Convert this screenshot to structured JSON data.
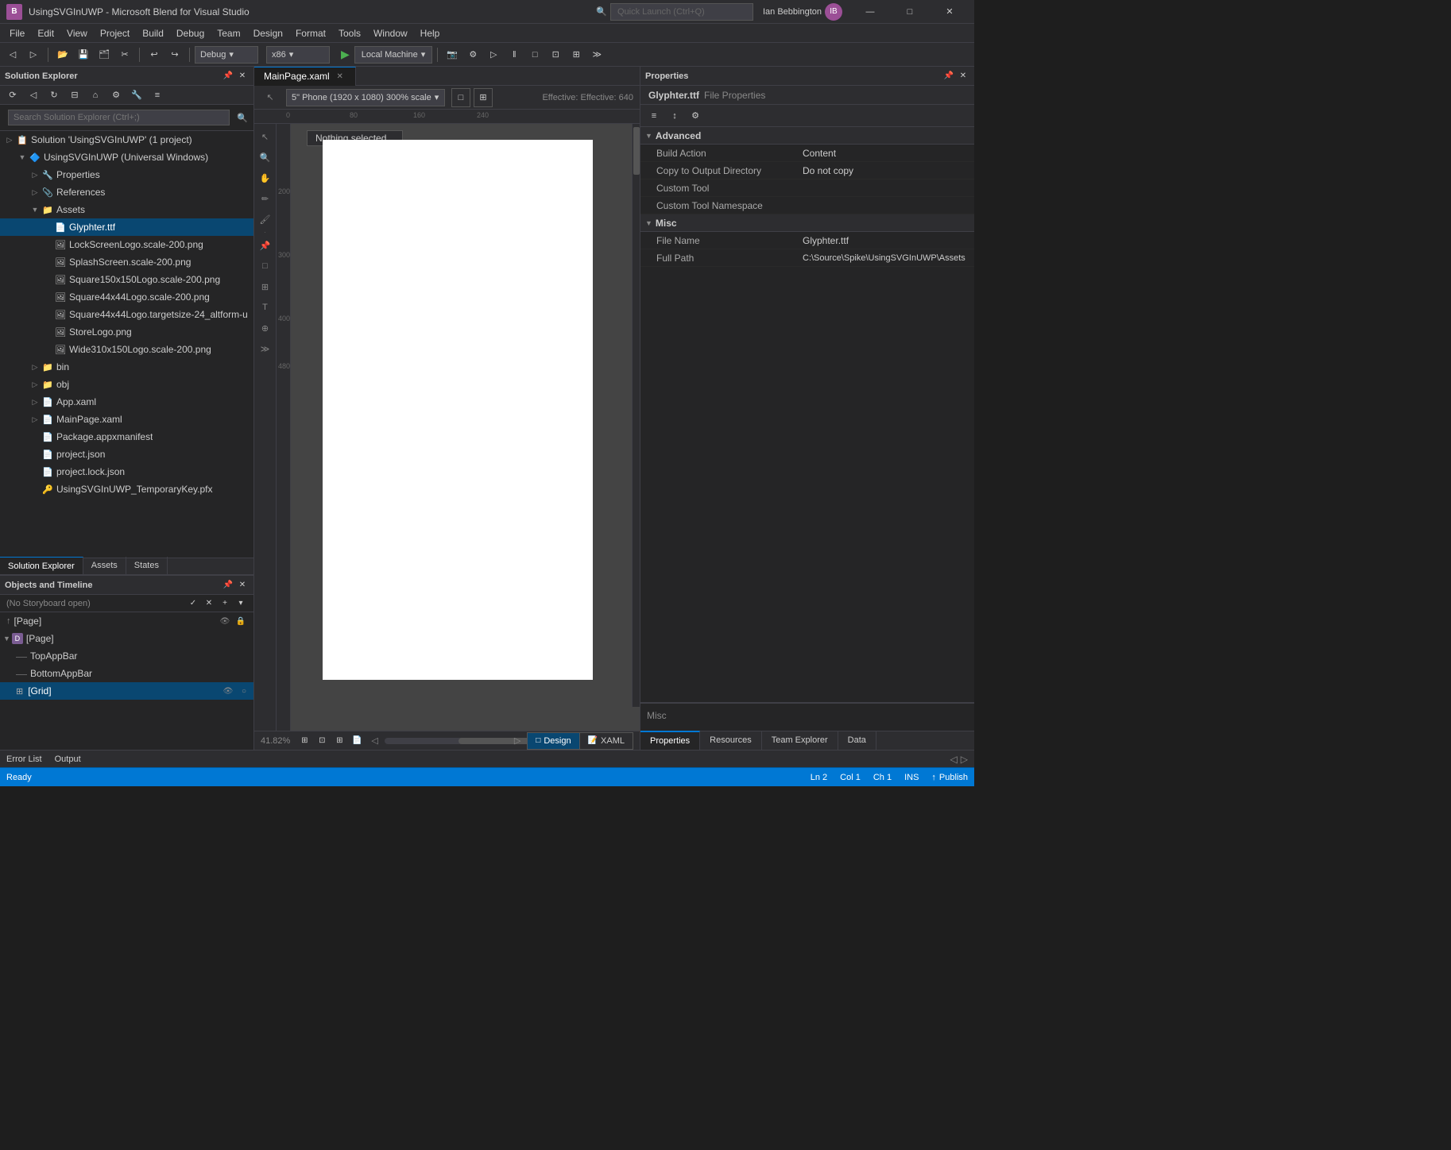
{
  "app": {
    "title": "UsingSVGInUWP - Microsoft Blend for Visual Studio",
    "logo": "B"
  },
  "titlebar": {
    "quick_launch_placeholder": "Quick Launch (Ctrl+Q)",
    "minimize": "—",
    "maximize": "□",
    "close": "✕"
  },
  "menu": {
    "items": [
      "File",
      "Edit",
      "View",
      "Project",
      "Build",
      "Debug",
      "Team",
      "Design",
      "Format",
      "Tools",
      "Window",
      "Help"
    ]
  },
  "toolbar": {
    "debug_config": "Debug",
    "platform": "x86",
    "run_btn": "▶",
    "local_machine": "Local Machine",
    "undo": "↩",
    "redo": "↪"
  },
  "solution_explorer": {
    "title": "Solution Explorer",
    "search_placeholder": "Search Solution Explorer (Ctrl+;)",
    "tree": [
      {
        "id": "solution",
        "label": "Solution 'UsingSVGInUWP' (1 project)",
        "indent": 0,
        "expand": "▷",
        "icon": "📋",
        "expanded": true
      },
      {
        "id": "project",
        "label": "UsingSVGInUWP (Universal Windows)",
        "indent": 1,
        "expand": "▼",
        "icon": "🔷",
        "expanded": true
      },
      {
        "id": "properties",
        "label": "Properties",
        "indent": 2,
        "expand": "▷",
        "icon": "🔧"
      },
      {
        "id": "references",
        "label": "References",
        "indent": 2,
        "expand": "▷",
        "icon": "📎"
      },
      {
        "id": "assets",
        "label": "Assets",
        "indent": 2,
        "expand": "▼",
        "icon": "📁",
        "expanded": true
      },
      {
        "id": "glyphter",
        "label": "Glyphter.ttf",
        "indent": 3,
        "icon": "📄",
        "selected": true
      },
      {
        "id": "lockscreen",
        "label": "LockScreenLogo.scale-200.png",
        "indent": 3,
        "icon": "🖼"
      },
      {
        "id": "splashscreen",
        "label": "SplashScreen.scale-200.png",
        "indent": 3,
        "icon": "🖼"
      },
      {
        "id": "square150",
        "label": "Square150x150Logo.scale-200.png",
        "indent": 3,
        "icon": "🖼"
      },
      {
        "id": "square44",
        "label": "Square44x44Logo.scale-200.png",
        "indent": 3,
        "icon": "🖼"
      },
      {
        "id": "square44alt",
        "label": "Square44x44Logo.targetsize-24_altform-u",
        "indent": 3,
        "icon": "🖼"
      },
      {
        "id": "storelogo",
        "label": "StoreLogo.png",
        "indent": 3,
        "icon": "🖼"
      },
      {
        "id": "wide310",
        "label": "Wide310x150Logo.scale-200.png",
        "indent": 3,
        "icon": "🖼"
      },
      {
        "id": "bin",
        "label": "bin",
        "indent": 2,
        "expand": "▷",
        "icon": "📁"
      },
      {
        "id": "obj",
        "label": "obj",
        "indent": 2,
        "expand": "▷",
        "icon": "📁"
      },
      {
        "id": "appxaml",
        "label": "App.xaml",
        "indent": 2,
        "expand": "▷",
        "icon": "📄"
      },
      {
        "id": "mainpagexaml",
        "label": "MainPage.xaml",
        "indent": 2,
        "expand": "▷",
        "icon": "📄"
      },
      {
        "id": "packagemanifest",
        "label": "Package.appxmanifest",
        "indent": 2,
        "icon": "📄"
      },
      {
        "id": "projectjson",
        "label": "project.json",
        "indent": 2,
        "icon": "📄"
      },
      {
        "id": "projectlockjson",
        "label": "project.lock.json",
        "indent": 2,
        "icon": "📄"
      },
      {
        "id": "temporarykey",
        "label": "UsingSVGInUWP_TemporaryKey.pfx",
        "indent": 2,
        "icon": "🔑"
      }
    ]
  },
  "bottom_left_tabs": {
    "tabs": [
      "Solution Explorer",
      "Assets",
      "States"
    ],
    "active": "Solution Explorer"
  },
  "objects_panel": {
    "title": "Objects and Timeline",
    "storyboard": "(No Storyboard open)",
    "tree": [
      {
        "id": "page-header",
        "label": "[Page]",
        "indent": 0,
        "icon": "↑"
      },
      {
        "id": "page-node",
        "label": "[Page]",
        "indent": 0,
        "expand": "▼",
        "icon": "D",
        "expanded": true
      },
      {
        "id": "topappbar",
        "label": "TopAppBar",
        "indent": 1,
        "icon": "—"
      },
      {
        "id": "bottomappbar",
        "label": "BottomAppBar",
        "indent": 1,
        "icon": "—"
      },
      {
        "id": "grid",
        "label": "[Grid]",
        "indent": 1,
        "icon": "⊞",
        "selected": true
      }
    ]
  },
  "editor": {
    "tabs": [
      {
        "label": "MainPage.xaml",
        "active": true
      },
      {
        "label": "×",
        "is_close": true
      }
    ],
    "active_tab": "MainPage.xaml",
    "device_select": "5\" Phone (1920 x 1080) 300% scale",
    "effective_label": "Effective: 640",
    "nothing_selected": "Nothing selected _",
    "zoom": "41.82%",
    "ruler_marks_h": [
      "0",
      "80",
      "160",
      "240"
    ],
    "ruler_marks_v": [
      "200",
      "300",
      "400",
      "480"
    ],
    "view_tabs": [
      "Design",
      "XAML"
    ]
  },
  "properties": {
    "title": "Properties",
    "file_name": "Glyphter.ttf",
    "file_props": "File Properties",
    "sections": [
      {
        "id": "advanced",
        "label": "Advanced",
        "expanded": true,
        "rows": [
          {
            "label": "Build Action",
            "value": "Content"
          },
          {
            "label": "Copy to Output Directory",
            "value": "Do not copy"
          },
          {
            "label": "Custom Tool",
            "value": ""
          },
          {
            "label": "Custom Tool Namespace",
            "value": ""
          }
        ]
      },
      {
        "id": "misc",
        "label": "Misc",
        "expanded": true,
        "rows": [
          {
            "label": "File Name",
            "value": "Glyphter.ttf"
          },
          {
            "label": "Full Path",
            "value": "C:\\Source\\Spike\\UsingSVGInUWP\\Assets"
          }
        ]
      }
    ],
    "bottom_misc": "Misc"
  },
  "right_bottom_tabs": {
    "tabs": [
      "Properties",
      "Resources",
      "Team Explorer",
      "Data"
    ],
    "active": "Properties"
  },
  "status_bar": {
    "ready": "Ready",
    "ln": "Ln 2",
    "col": "Col 1",
    "ch": "Ch 1",
    "ins": "INS",
    "publish": "Publish"
  },
  "error_bar": {
    "items": [
      "Error List",
      "Output"
    ]
  }
}
